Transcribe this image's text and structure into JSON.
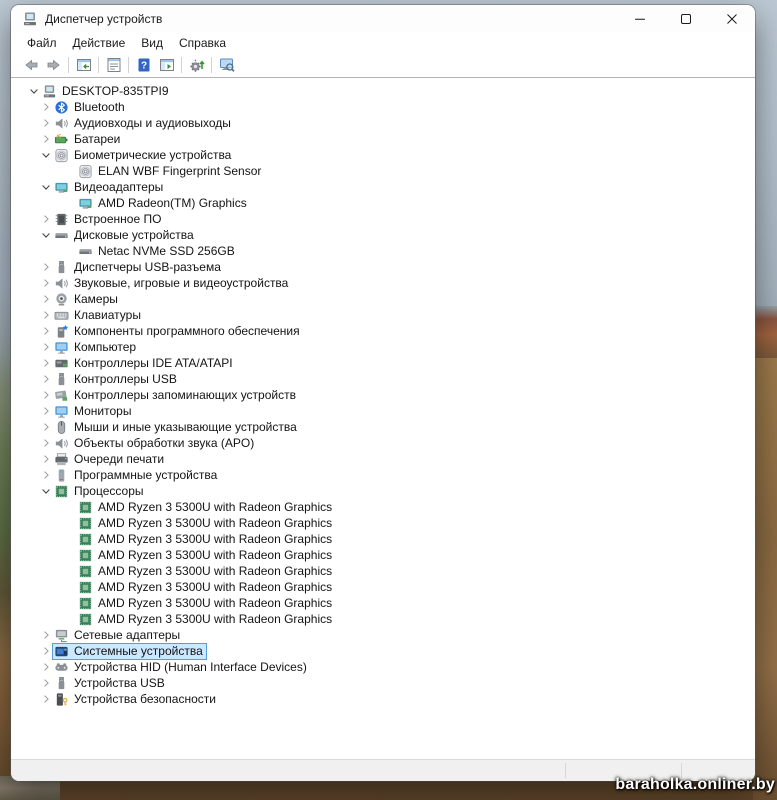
{
  "window": {
    "title": "Диспетчер устройств"
  },
  "menu": {
    "items": [
      "Файл",
      "Действие",
      "Вид",
      "Справка"
    ]
  },
  "toolbar": {
    "buttons": [
      "back",
      "forward",
      "|",
      "show-hide-console-tree",
      "|",
      "properties",
      "|",
      "help",
      "show-action-pane",
      "|",
      "update-driver",
      "|",
      "scan-hardware-changes"
    ]
  },
  "tree": {
    "items": [
      {
        "label": "DESKTOP-835TPI9",
        "level": 0,
        "state": "expanded",
        "icon": "computer"
      },
      {
        "label": "Bluetooth",
        "level": 1,
        "state": "collapsed",
        "icon": "bluetooth"
      },
      {
        "label": "Аудиовходы и аудиовыходы",
        "level": 1,
        "state": "collapsed",
        "icon": "audio"
      },
      {
        "label": "Батареи",
        "level": 1,
        "state": "collapsed",
        "icon": "battery"
      },
      {
        "label": "Биометрические устройства",
        "level": 1,
        "state": "expanded",
        "icon": "fingerprint"
      },
      {
        "label": "ELAN WBF Fingerprint Sensor",
        "level": 2,
        "state": "none",
        "icon": "fingerprint"
      },
      {
        "label": "Видеоадаптеры",
        "level": 1,
        "state": "expanded",
        "icon": "display-adapter"
      },
      {
        "label": "AMD Radeon(TM) Graphics",
        "level": 2,
        "state": "none",
        "icon": "display-adapter"
      },
      {
        "label": "Встроенное ПО",
        "level": 1,
        "state": "collapsed",
        "icon": "firmware"
      },
      {
        "label": "Дисковые устройства",
        "level": 1,
        "state": "expanded",
        "icon": "disk"
      },
      {
        "label": "Netac NVMe SSD 256GB",
        "level": 2,
        "state": "none",
        "icon": "disk"
      },
      {
        "label": "Диспетчеры USB-разъема",
        "level": 1,
        "state": "collapsed",
        "icon": "usb"
      },
      {
        "label": "Звуковые, игровые и видеоустройства",
        "level": 1,
        "state": "collapsed",
        "icon": "audio"
      },
      {
        "label": "Камеры",
        "level": 1,
        "state": "collapsed",
        "icon": "camera"
      },
      {
        "label": "Клавиатуры",
        "level": 1,
        "state": "collapsed",
        "icon": "keyboard"
      },
      {
        "label": "Компоненты программного обеспечения",
        "level": 1,
        "state": "collapsed",
        "icon": "software-component"
      },
      {
        "label": "Компьютер",
        "level": 1,
        "state": "collapsed",
        "icon": "monitor"
      },
      {
        "label": "Контроллеры IDE ATA/ATAPI",
        "level": 1,
        "state": "collapsed",
        "icon": "ide"
      },
      {
        "label": "Контроллеры USB",
        "level": 1,
        "state": "collapsed",
        "icon": "usb"
      },
      {
        "label": "Контроллеры запоминающих устройств",
        "level": 1,
        "state": "collapsed",
        "icon": "storage"
      },
      {
        "label": "Мониторы",
        "level": 1,
        "state": "collapsed",
        "icon": "monitor"
      },
      {
        "label": "Мыши и иные указывающие устройства",
        "level": 1,
        "state": "collapsed",
        "icon": "mouse"
      },
      {
        "label": "Объекты обработки звука (APO)",
        "level": 1,
        "state": "collapsed",
        "icon": "audio"
      },
      {
        "label": "Очереди печати",
        "level": 1,
        "state": "collapsed",
        "icon": "printer"
      },
      {
        "label": "Программные устройства",
        "level": 1,
        "state": "collapsed",
        "icon": "software-device"
      },
      {
        "label": "Процессоры",
        "level": 1,
        "state": "expanded",
        "icon": "cpu"
      },
      {
        "label": "AMD Ryzen 3 5300U with Radeon Graphics",
        "level": 2,
        "state": "none",
        "icon": "cpu"
      },
      {
        "label": "AMD Ryzen 3 5300U with Radeon Graphics",
        "level": 2,
        "state": "none",
        "icon": "cpu"
      },
      {
        "label": "AMD Ryzen 3 5300U with Radeon Graphics",
        "level": 2,
        "state": "none",
        "icon": "cpu"
      },
      {
        "label": "AMD Ryzen 3 5300U with Radeon Graphics",
        "level": 2,
        "state": "none",
        "icon": "cpu"
      },
      {
        "label": "AMD Ryzen 3 5300U with Radeon Graphics",
        "level": 2,
        "state": "none",
        "icon": "cpu"
      },
      {
        "label": "AMD Ryzen 3 5300U with Radeon Graphics",
        "level": 2,
        "state": "none",
        "icon": "cpu"
      },
      {
        "label": "AMD Ryzen 3 5300U with Radeon Graphics",
        "level": 2,
        "state": "none",
        "icon": "cpu"
      },
      {
        "label": "AMD Ryzen 3 5300U with Radeon Graphics",
        "level": 2,
        "state": "none",
        "icon": "cpu"
      },
      {
        "label": "Сетевые адаптеры",
        "level": 1,
        "state": "collapsed",
        "icon": "network"
      },
      {
        "label": "Системные устройства",
        "level": 1,
        "state": "collapsed",
        "icon": "system",
        "selected": true
      },
      {
        "label": "Устройства HID (Human Interface Devices)",
        "level": 1,
        "state": "collapsed",
        "icon": "hid"
      },
      {
        "label": "Устройства USB",
        "level": 1,
        "state": "collapsed",
        "icon": "usb"
      },
      {
        "label": "Устройства безопасности",
        "level": 1,
        "state": "collapsed",
        "icon": "security"
      }
    ]
  },
  "watermark": "baraholka.onliner.by"
}
